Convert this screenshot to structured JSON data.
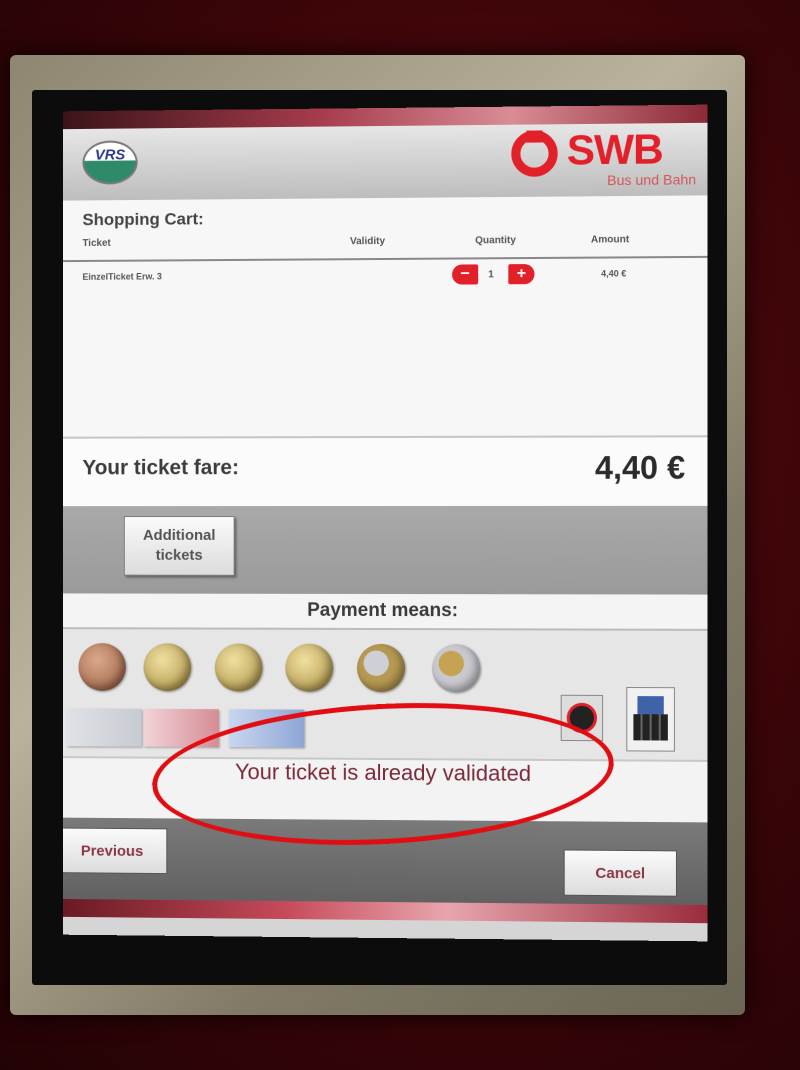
{
  "header": {
    "vrs_logo_text": "VRS",
    "swb_logo_text": "SWB",
    "swb_subtitle": "Bus und Bahn"
  },
  "cart": {
    "title": "Shopping Cart:",
    "columns": {
      "ticket": "Ticket",
      "validity": "Validity",
      "quantity": "Quantity",
      "amount": "Amount"
    },
    "rows": [
      {
        "ticket": "EinzelTicket Erw. 3",
        "validity": "",
        "quantity": "1",
        "amount": "4,40 €"
      }
    ],
    "minus_label": "−",
    "plus_label": "+"
  },
  "fare": {
    "label": "Your ticket fare:",
    "amount": "4,40 €"
  },
  "additional_tickets_label": "Additional tickets",
  "payment": {
    "title": "Payment means:",
    "coins": [
      "coin-10c",
      "coin-20c",
      "coin-50c",
      "coin-50c-2",
      "coin-1eur",
      "coin-2eur"
    ],
    "notes": [
      "5",
      "10",
      "20"
    ],
    "card_icons": [
      "girocard-icon",
      "geldkarte-icon"
    ]
  },
  "message": "Your ticket is already validated",
  "nav": {
    "previous_label": "Previous",
    "cancel_label": "Cancel"
  },
  "colors": {
    "brand_red": "#e2202a",
    "annotation_red": "#e00d12",
    "message_text": "#7b2a38"
  }
}
